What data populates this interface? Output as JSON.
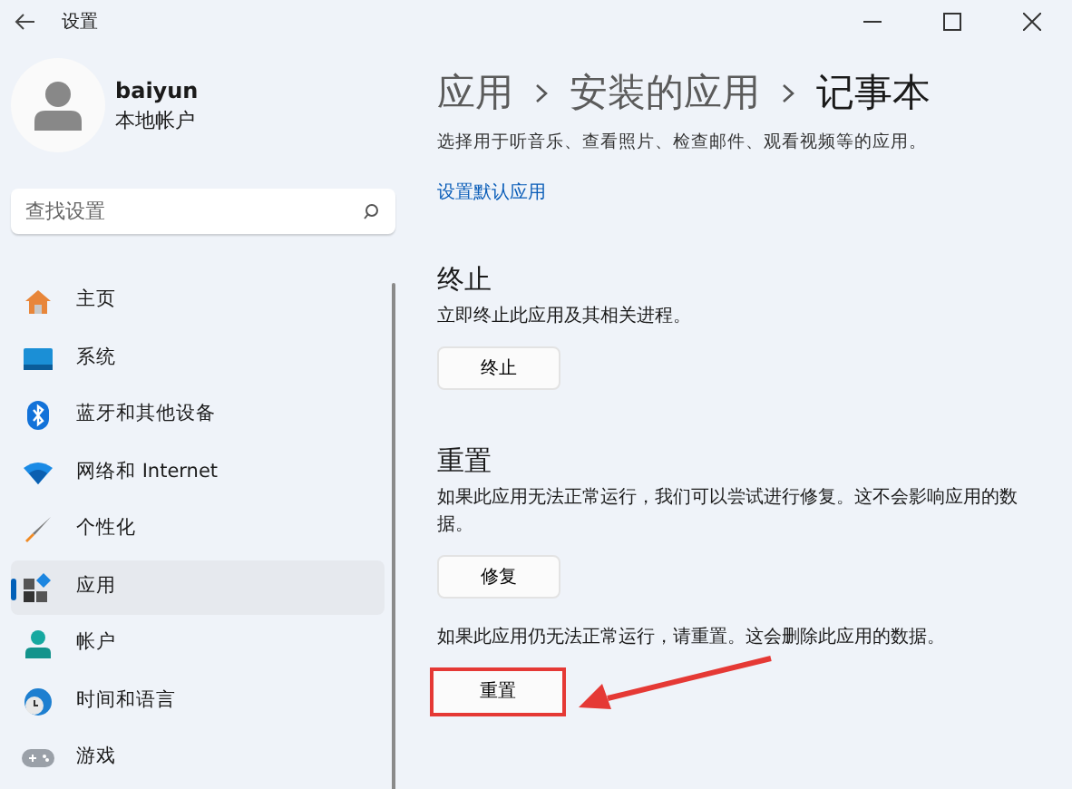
{
  "window": {
    "title": "设置"
  },
  "user": {
    "name": "baiyun",
    "account_type": "本地帐户"
  },
  "search": {
    "placeholder": "查找设置"
  },
  "sidebar": {
    "items": [
      {
        "label": "主页",
        "selected": false
      },
      {
        "label": "系统",
        "selected": false
      },
      {
        "label": "蓝牙和其他设备",
        "selected": false
      },
      {
        "label": "网络和 Internet",
        "selected": false
      },
      {
        "label": "个性化",
        "selected": false
      },
      {
        "label": "应用",
        "selected": true
      },
      {
        "label": "帐户",
        "selected": false
      },
      {
        "label": "时间和语言",
        "selected": false
      },
      {
        "label": "游戏",
        "selected": false
      }
    ]
  },
  "breadcrumb": [
    {
      "label": "应用",
      "current": false
    },
    {
      "label": "安装的应用",
      "current": false
    },
    {
      "label": "记事本",
      "current": true
    }
  ],
  "intro": "选择用于听音乐、查看照片、检查邮件、观看视频等的应用。",
  "link": "设置默认应用",
  "sections": [
    {
      "heading": "终止",
      "blocks": [
        {
          "text": "立即终止此应用及其相关进程。",
          "button": "终止",
          "highlighted": false
        }
      ]
    },
    {
      "heading": "重置",
      "blocks": [
        {
          "text": "如果此应用无法正常运行，我们可以尝试进行修复。这不会影响应用的数据。",
          "button": "修复",
          "highlighted": false
        },
        {
          "text": "如果此应用仍无法正常运行，请重置。这会删除此应用的数据。",
          "button": "重置",
          "highlighted": true
        }
      ]
    }
  ]
}
